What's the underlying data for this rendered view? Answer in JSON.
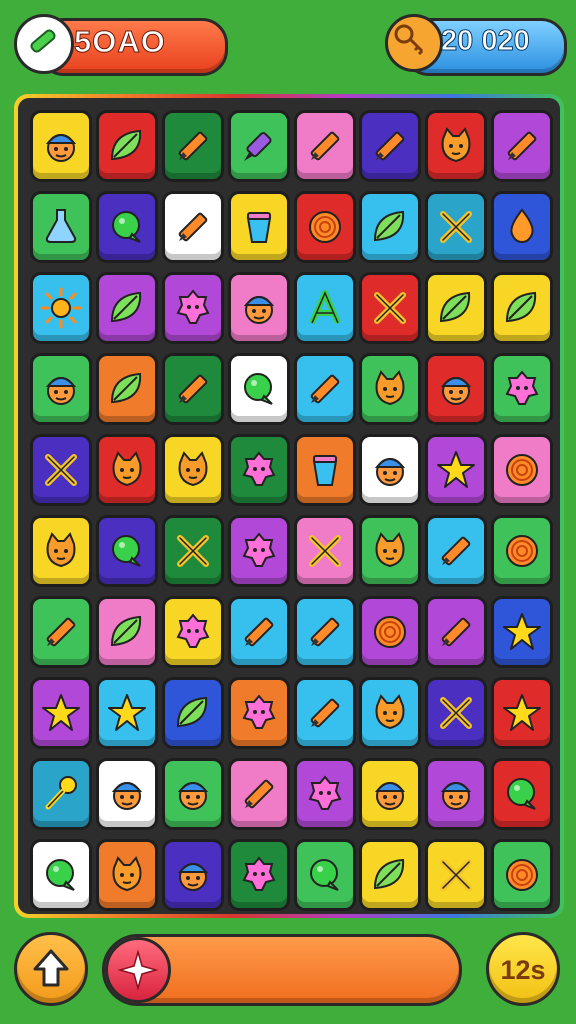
{
  "hud": {
    "score": {
      "value": "5OAO",
      "icon": "pencil-icon"
    },
    "coins": {
      "value": "20 020",
      "icon": "key-tag-icon"
    }
  },
  "board": {
    "rows": [
      [
        [
          "#f7d626",
          "face"
        ],
        [
          "#e02b2b",
          "leaf"
        ],
        [
          "#1f8a3b",
          "pencil"
        ],
        [
          "#3fc25a",
          "marker"
        ],
        [
          "#f07cc8",
          "pencil"
        ],
        [
          "#4a2fc0",
          "pencil"
        ],
        [
          "#e02b2b",
          "cat"
        ],
        [
          "#b248d8",
          "pencil"
        ]
      ],
      [
        [
          "#3fc25a",
          "flask"
        ],
        [
          "#4a2fc0",
          "bubble"
        ],
        [
          "#ffffff",
          "pencil"
        ],
        [
          "#f7d626",
          "cup"
        ],
        [
          "#e02b2b",
          "swirl"
        ],
        [
          "#37c0ee",
          "leaf"
        ],
        [
          "#2aa4c8",
          "cross"
        ],
        [
          "#2f55d8",
          "drop"
        ]
      ],
      [
        [
          "#37c0ee",
          "sun"
        ],
        [
          "#b248d8",
          "leaf"
        ],
        [
          "#b248d8",
          "blob"
        ],
        [
          "#f07cc8",
          "face"
        ],
        [
          "#37c0ee",
          "letter"
        ],
        [
          "#e02b2b",
          "cross"
        ],
        [
          "#f7d626",
          "leaf"
        ],
        [
          "#f7d626",
          "leaf"
        ]
      ],
      [
        [
          "#3fc25a",
          "face"
        ],
        [
          "#f07b2a",
          "leaf"
        ],
        [
          "#1f8a3b",
          "pencil"
        ],
        [
          "#ffffff",
          "bubble"
        ],
        [
          "#37c0ee",
          "pencil"
        ],
        [
          "#3fc25a",
          "cat"
        ],
        [
          "#e02b2b",
          "face"
        ],
        [
          "#3fc25a",
          "blob"
        ]
      ],
      [
        [
          "#4a2fc0",
          "cross"
        ],
        [
          "#e02b2b",
          "cat"
        ],
        [
          "#f7d626",
          "cat"
        ],
        [
          "#1f8a3b",
          "blob"
        ],
        [
          "#f07b2a",
          "cup"
        ],
        [
          "#ffffff",
          "face"
        ],
        [
          "#b248d8",
          "star"
        ],
        [
          "#f07cc8",
          "swirl"
        ]
      ],
      [
        [
          "#f7d626",
          "cat"
        ],
        [
          "#4a2fc0",
          "bubble"
        ],
        [
          "#1f8a3b",
          "cross"
        ],
        [
          "#b248d8",
          "blob"
        ],
        [
          "#f07cc8",
          "cross"
        ],
        [
          "#3fc25a",
          "cat"
        ],
        [
          "#37c0ee",
          "pencil"
        ],
        [
          "#3fc25a",
          "swirl"
        ]
      ],
      [
        [
          "#3fc25a",
          "pencil"
        ],
        [
          "#f07cc8",
          "leaf"
        ],
        [
          "#f7d626",
          "blob"
        ],
        [
          "#37c0ee",
          "pencil"
        ],
        [
          "#37c0ee",
          "pencil"
        ],
        [
          "#b248d8",
          "swirl"
        ],
        [
          "#b248d8",
          "pencil"
        ],
        [
          "#2f55d8",
          "star"
        ]
      ],
      [
        [
          "#b248d8",
          "star"
        ],
        [
          "#37c0ee",
          "star"
        ],
        [
          "#2f55d8",
          "leaf"
        ],
        [
          "#f07b2a",
          "blob"
        ],
        [
          "#37c0ee",
          "pencil"
        ],
        [
          "#37c0ee",
          "cat"
        ],
        [
          "#4a2fc0",
          "cross"
        ],
        [
          "#e02b2b",
          "star"
        ]
      ],
      [
        [
          "#2aa4c8",
          "key"
        ],
        [
          "#ffffff",
          "face"
        ],
        [
          "#3fc25a",
          "face"
        ],
        [
          "#f07cc8",
          "pencil"
        ],
        [
          "#b248d8",
          "blob"
        ],
        [
          "#f7d626",
          "face"
        ],
        [
          "#b248d8",
          "face"
        ],
        [
          "#e02b2b",
          "bubble"
        ]
      ],
      [
        [
          "#ffffff",
          "bubble"
        ],
        [
          "#f07b2a",
          "cat"
        ],
        [
          "#4a2fc0",
          "face"
        ],
        [
          "#1f8a3b",
          "blob"
        ],
        [
          "#3fc25a",
          "bubble"
        ],
        [
          "#f7d626",
          "leaf"
        ],
        [
          "#f7d626",
          "cross"
        ],
        [
          "#3fc25a",
          "swirl"
        ]
      ]
    ]
  },
  "footer": {
    "left_icon": "up-arrow-icon",
    "slider_icon": "sparkle-icon",
    "timer": "12s"
  }
}
